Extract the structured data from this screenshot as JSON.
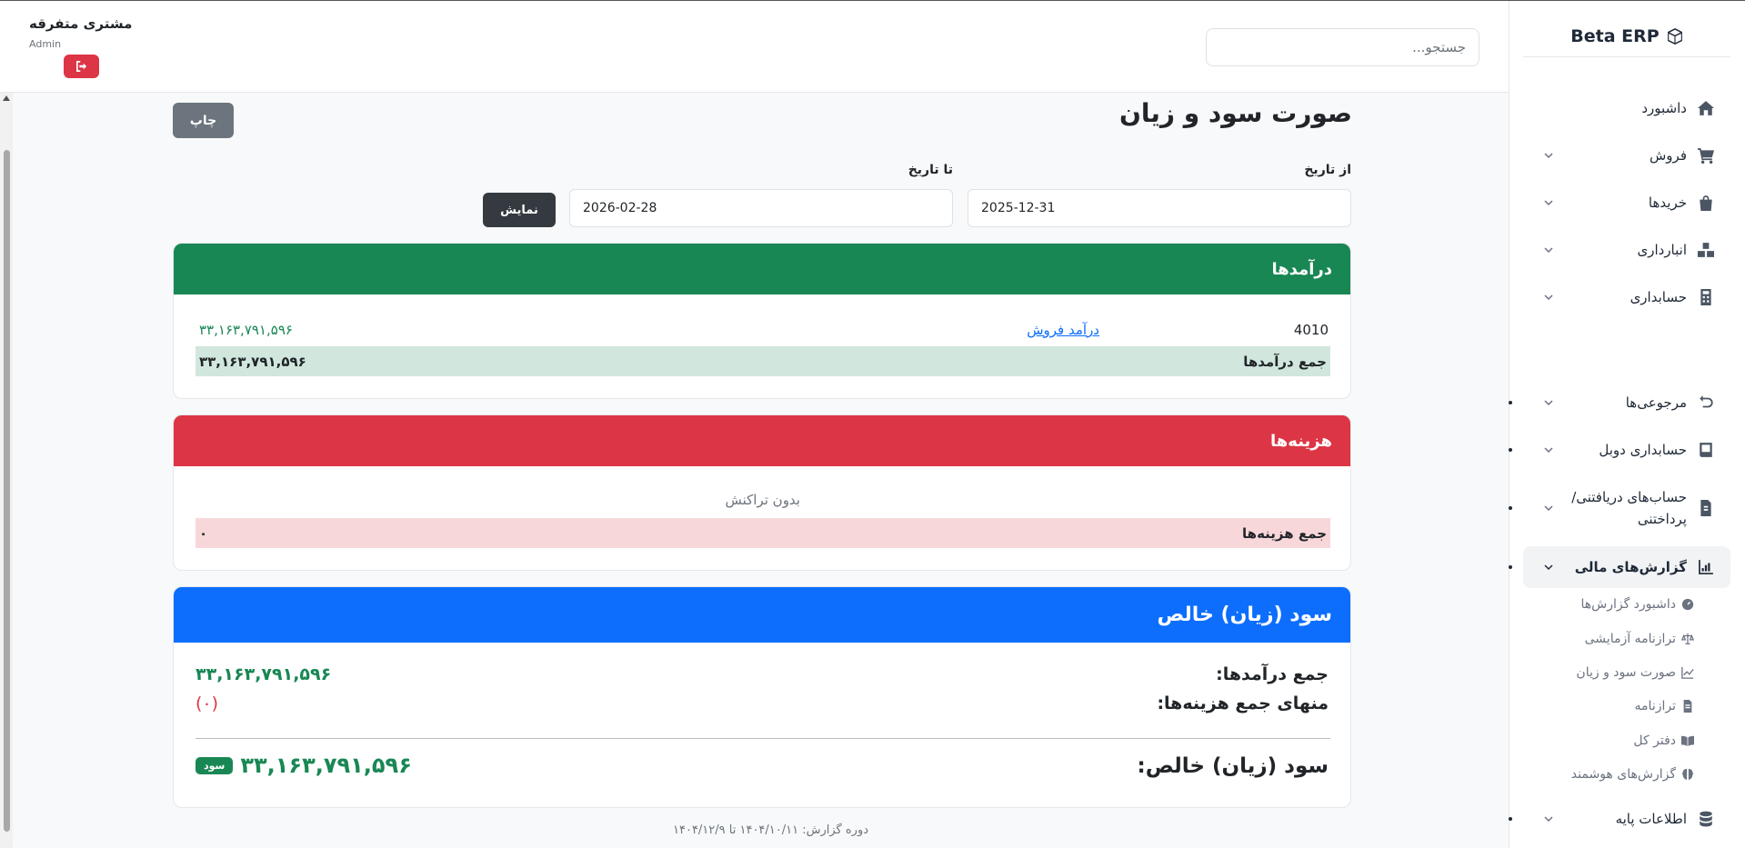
{
  "app": {
    "brand": "Beta ERP"
  },
  "header": {
    "search_placeholder": "جستجو...",
    "user_name": "مشتری متفرقه",
    "user_role": "Admin"
  },
  "sidebar": {
    "items": [
      {
        "label": "داشبورد",
        "icon": "home-icon"
      },
      {
        "label": "فروش",
        "icon": "cart-icon"
      },
      {
        "label": "خریدها",
        "icon": "bag-icon"
      },
      {
        "label": "انبارداری",
        "icon": "boxes-icon"
      },
      {
        "label": "حسابداری",
        "icon": "calculator-icon"
      },
      {
        "label": "مرجوعی‌ها",
        "icon": "undo-icon"
      },
      {
        "label": "حسابداری دوبل",
        "icon": "book-icon"
      },
      {
        "label": "حساب‌های دریافتنی/ پرداختنی",
        "icon": "invoice-icon"
      },
      {
        "label": "گزارش‌های مالی",
        "icon": "chart-icon"
      },
      {
        "label": "اطلاعات پایه",
        "icon": "database-icon"
      }
    ],
    "sub_items": [
      {
        "label": "داشبورد گزارش‌ها",
        "icon": "gauge-icon"
      },
      {
        "label": "ترازنامه آزمایشی",
        "icon": "scale-icon"
      },
      {
        "label": "صورت سود و زیان",
        "icon": "line-chart-icon"
      },
      {
        "label": "ترازنامه",
        "icon": "file-icon"
      },
      {
        "label": "دفتر کل",
        "icon": "open-book-icon"
      },
      {
        "label": "گزارش‌های هوشمند",
        "icon": "brain-icon"
      }
    ]
  },
  "page": {
    "title": "صورت سود و زیان",
    "print_label": "چاپ",
    "from_label": "از تاریخ",
    "to_label": "تا تاریخ",
    "from_value": "2025-12-31",
    "to_value": "2026-02-28",
    "show_label": "نمایش"
  },
  "revenues": {
    "title": "درآمدها",
    "rows": [
      {
        "code": "4010",
        "name": "درآمد فروش",
        "amount": "۳۳,۱۶۳,۷۹۱,۵۹۶"
      }
    ],
    "total_label": "جمع درآمدها",
    "total_value": "۳۳,۱۶۳,۷۹۱,۵۹۶"
  },
  "expenses": {
    "title": "هزینه‌ها",
    "empty_text": "بدون تراکنش",
    "total_label": "جمع هزینه‌ها",
    "total_value": "۰"
  },
  "net": {
    "title": "سود (زیان) خالص",
    "revenue_label": "جمع درآمدها:",
    "revenue_value": "۳۳,۱۶۳,۷۹۱,۵۹۶",
    "expense_label": "منهای جمع هزینه‌ها:",
    "expense_value": "(۰)",
    "net_label": "سود (زیان) خالص:",
    "net_value": "۳۳,۱۶۳,۷۹۱,۵۹۶",
    "badge": "سود"
  },
  "footer": {
    "period": "دوره گزارش: ۱۴۰۴/۱۰/۱۱ تا ۱۴۰۴/۱۲/۹"
  },
  "colors": {
    "green": "#198754",
    "red": "#dc3545",
    "blue": "#0d6efd",
    "dark": "#343a40"
  }
}
